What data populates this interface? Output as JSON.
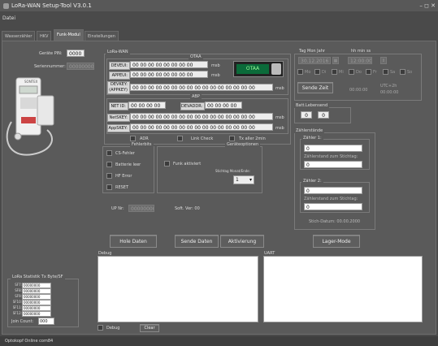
{
  "window": {
    "title": "LoRa-WAN Setup-Tool V3.0.1",
    "controls": "– ◻ ✕"
  },
  "menu": {
    "datei": "Datei"
  },
  "tabs": [
    {
      "label": "Wasserzähler"
    },
    {
      "label": "HKV"
    },
    {
      "label": "Funk-Modul"
    },
    {
      "label": "Einstellungen"
    }
  ],
  "left": {
    "geraete_pin_label": "Geräte PIN:",
    "geraete_pin_value": "0000",
    "seriennummer_label": "Seriennummer:",
    "seriennummer_value": "00000000",
    "device_brand": "SONTEX"
  },
  "lorawan": {
    "title": "LoRa-WAN",
    "otaa_title": "OTAA",
    "deveui_label": "DEVEUI:",
    "deveui_value": "00 00 00 00 00 00 00 00",
    "deveui_unit": "msb",
    "appeui_label": "APPEUI:",
    "appeui_value": "00 00 00 00 00 00 00 00",
    "appeui_unit": "msb",
    "devkey_label": "DEVKEY:\n(APPKEY)",
    "devkey_value": "00 00 00 00 00 00 00 00 00 00 00 00 00 00 00 00",
    "devkey_unit": "msb",
    "otaa_toggle": "OTAA",
    "abp_title": "ABP",
    "netid_label": "NET ID:",
    "netid_value": "00 00 00 00",
    "devaddr_label": "DEVADDR:",
    "devaddr_value": "00 00 00 00",
    "netskey_label": "NetSKEY:",
    "netskey_value": "00 00 00 00 00 00 00 00 00 00 00 00 00 00 00 00",
    "netskey_unit": "msb",
    "appskey_label": "AppSKEY:",
    "appskey_value": "00 00 00 00 00 00 00 00 00 00 00 00 00 00 00 00",
    "appskey_unit": "msb",
    "adr_label": "ADR",
    "linkcheck_label": "Link Check",
    "txalle_label": "Tx aller 2min"
  },
  "fehlerbits": {
    "title": "Fehlerbits",
    "items": [
      "CS-Fehler",
      "Batterie leer",
      "HF Error",
      "RESET"
    ]
  },
  "geraeteoptionen": {
    "title": "Geräteoptionen",
    "funk_label": "Funk aktiviert",
    "stichtag_label": "Stichtag Monat/Ende:",
    "select_value": "1",
    "select_arrow": "▾"
  },
  "misc": {
    "up_nr_label": "UP Nr:",
    "up_nr_value": "00000000",
    "soft_ver": "Soft. Ver: 00"
  },
  "buttons": {
    "hole_daten": "Hole Daten",
    "sende_daten": "Sende Daten",
    "aktivierung": "Aktivierung",
    "lager_mode": "Lager-Mode",
    "sende_zeit": "Sende Zeit",
    "clear": "Clear"
  },
  "time": {
    "header_date": "Tag  Mon  Jahr",
    "header_time": "hh  min  ss",
    "date_value": "30.12.2016",
    "time_value": "12:00:00",
    "days": [
      "Mo",
      "Di",
      "Mi",
      "Do",
      "Fr",
      "Sa",
      "So"
    ],
    "clock_value": "00:00:00",
    "utc_label": "UTC+2h",
    "utc_time": "00:00:00"
  },
  "batt": {
    "title": "Batt.Lebensend",
    "v1": "0",
    "v2": "0"
  },
  "zaehlerstaende": {
    "title": "Zählerstände",
    "z1_label": "Zähler 1:",
    "z1_value": "0",
    "z1_stich_label": "Zählerstand zum Stichtag:",
    "z1_stich_value": "0",
    "z2_label": "Zähler 2:",
    "z2_value": "0",
    "z2_stich_label": "Zählerstand zum Stichtag:",
    "z2_stich_value": "0",
    "stich_datum": "Stich-Datum: 00.00.2000"
  },
  "debug": {
    "label": "Debug",
    "checkbox_label": "Debug"
  },
  "uart": {
    "label": "UART"
  },
  "lorastat": {
    "title": "LoRa Statistik  Tx Byte/SF",
    "rows": [
      {
        "sf": "SF7:",
        "value": "00000000"
      },
      {
        "sf": "SF8:",
        "value": "00000000"
      },
      {
        "sf": "SF9:",
        "value": "00000000"
      },
      {
        "sf": "SF10:",
        "value": "00000000"
      },
      {
        "sf": "SF11:",
        "value": "00000000"
      },
      {
        "sf": "SF12:",
        "value": "00000000"
      }
    ],
    "join_label": "Join Count:",
    "join_value": "000"
  },
  "status": {
    "text": "Optokopf Online com84"
  }
}
